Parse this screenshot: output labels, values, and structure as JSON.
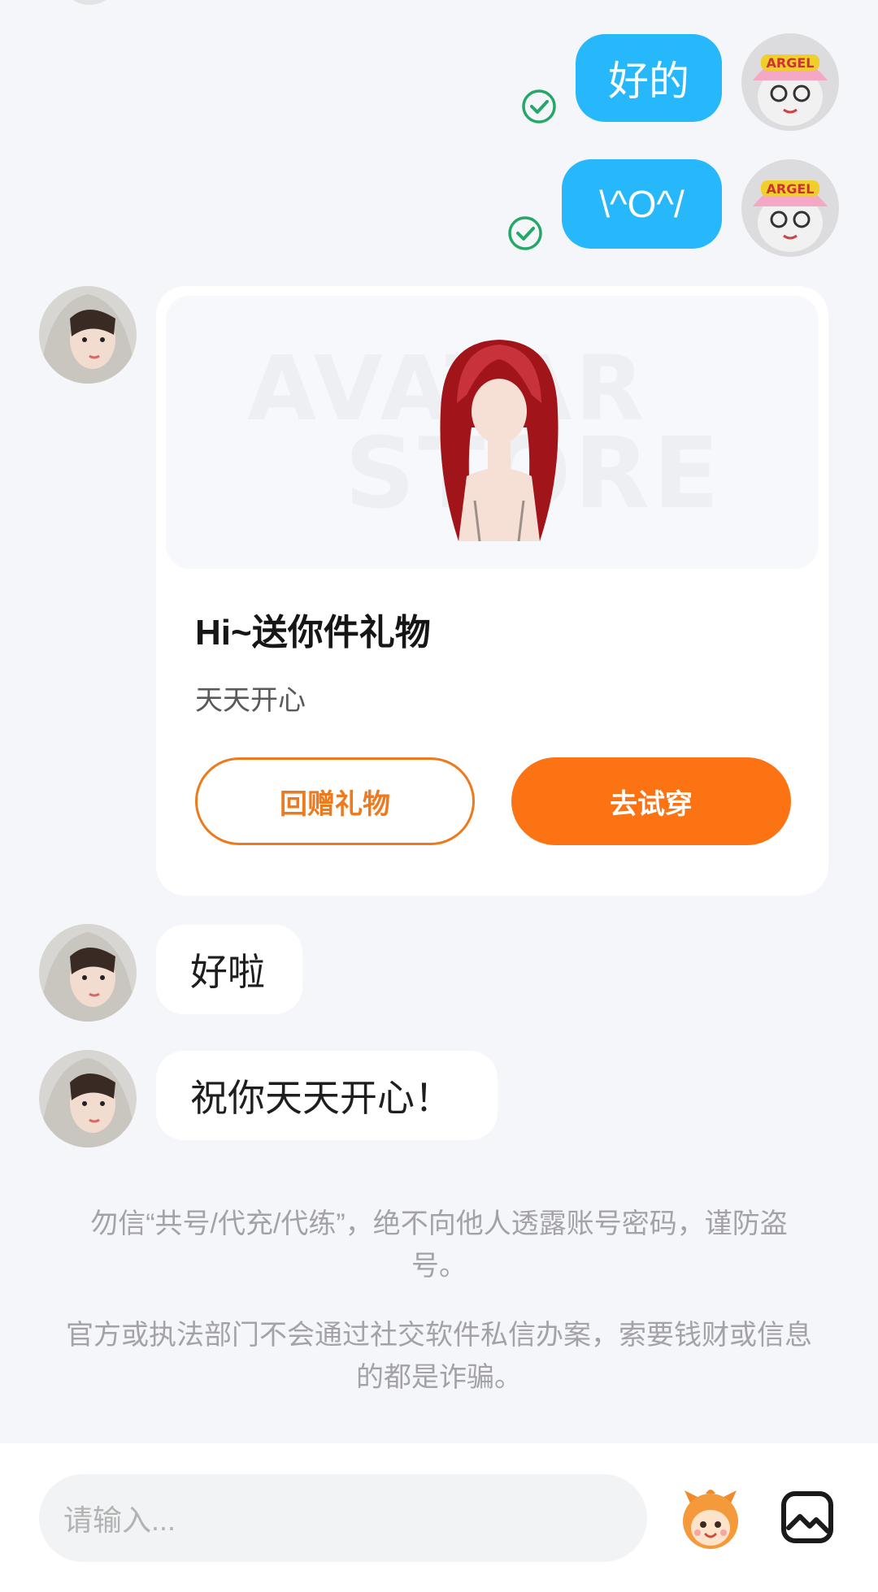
{
  "messages_sent": [
    {
      "text": "好的",
      "status": "read"
    },
    {
      "text": "\\^O^/",
      "status": "read"
    }
  ],
  "gift_card": {
    "image_watermark": [
      "AVATAR",
      "STORE"
    ],
    "title": "Hi~送你件礼物",
    "subtitle": "天天开心",
    "return_gift_label": "回赠礼物",
    "try_on_label": "去试穿"
  },
  "messages_received": [
    {
      "text": "好啦"
    },
    {
      "text": "祝你天天开心！"
    }
  ],
  "notices": [
    "勿信“共号/代充/代练”，绝不向他人透露账号密码，谨防盗号。",
    "官方或执法部门不会通过社交软件私信办案，索要钱财或信息的都是诈骗。"
  ],
  "input": {
    "placeholder": "请输入..."
  },
  "icons": {
    "read_check": "check-circle-icon",
    "sticker": "mascot-sticker-icon",
    "image": "image-icon"
  },
  "colors": {
    "sent_bubble": "#27b7fb",
    "accent_orange": "#fb7313",
    "read_green": "#23a867",
    "background": "#f5f6fa"
  }
}
